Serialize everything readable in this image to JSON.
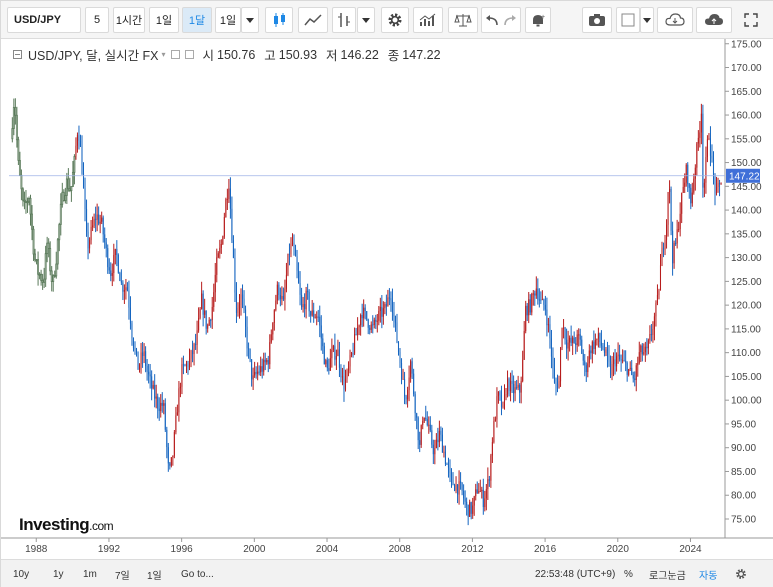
{
  "toolbar": {
    "symbol": "USD/JPY",
    "intervals": [
      "5",
      "1시간",
      "1일",
      "1달",
      "1일"
    ],
    "active_interval": "1달",
    "icons": [
      "chevron-down-icon",
      "candlestick-icon",
      "line-chart-icon",
      "indicator-icon",
      "chevron-down-icon",
      "gear-icon",
      "volume-icon",
      "scale-icon",
      "undo-icon",
      "redo-icon",
      "alert-bell-icon",
      "camera-icon",
      "color-square-icon",
      "chevron-down-icon",
      "cloud-load-icon",
      "cloud-save-icon",
      "fullscreen-icon"
    ]
  },
  "legend": {
    "name": "USD/JPY, 달, 실시간 FX",
    "open_label": "시",
    "open": "150.76",
    "high_label": "고",
    "high": "150.93",
    "low_label": "저",
    "low": "146.22",
    "close_label": "종",
    "close": "147.22"
  },
  "logo": {
    "brand": "Investing",
    "suffix": ".com"
  },
  "bottom": {
    "ranges": [
      "10y",
      "1y",
      "1m",
      "7일",
      "1일",
      "Go to..."
    ],
    "time": "22:53:48 (UTC+9)",
    "percent": "%",
    "log": "로그눈금",
    "auto": "자동",
    "settings_icon": "gear-icon"
  },
  "chart_data": {
    "type": "candlestick",
    "y_ticks": [
      75,
      80,
      85,
      90,
      95,
      100,
      105,
      110,
      115,
      120,
      125,
      130,
      135,
      140,
      145,
      150,
      155,
      160,
      165,
      170,
      175
    ],
    "x_ticks": [
      "1988",
      "1992",
      "1996",
      "2000",
      "2004",
      "2008",
      "2012",
      "2016",
      "2020",
      "2024"
    ],
    "ylim": [
      71,
      176
    ],
    "xlim": [
      1986.5,
      2025.9
    ],
    "last_price": 147.22,
    "last_price_label": "147.22",
    "colors": {
      "up": "#b71c1c",
      "down": "#1565c0",
      "hist": "#5a7a5a",
      "last": "#3f6fd8"
    },
    "series": {
      "name": "",
      "points": [
        [
          1986.6,
          155
        ],
        [
          1986.8,
          164
        ],
        [
          1987.0,
          150
        ],
        [
          1987.3,
          140
        ],
        [
          1987.6,
          143
        ],
        [
          1987.9,
          130
        ],
        [
          1988.1,
          127
        ],
        [
          1988.4,
          125
        ],
        [
          1988.6,
          133
        ],
        [
          1988.9,
          124
        ],
        [
          1989.1,
          130
        ],
        [
          1989.4,
          142
        ],
        [
          1989.7,
          146
        ],
        [
          1989.9,
          144
        ],
        [
          1990.1,
          150
        ],
        [
          1990.3,
          158
        ],
        [
          1990.5,
          150
        ],
        [
          1990.8,
          132
        ],
        [
          1991.0,
          135
        ],
        [
          1991.3,
          139
        ],
        [
          1991.6,
          137
        ],
        [
          1991.9,
          130
        ],
        [
          1992.1,
          127
        ],
        [
          1992.4,
          131
        ],
        [
          1992.7,
          124
        ],
        [
          1993.0,
          124
        ],
        [
          1993.3,
          113
        ],
        [
          1993.6,
          107
        ],
        [
          1993.9,
          110
        ],
        [
          1994.1,
          106
        ],
        [
          1994.4,
          102
        ],
        [
          1994.7,
          99
        ],
        [
          1995.0,
          99
        ],
        [
          1995.2,
          89
        ],
        [
          1995.3,
          84
        ],
        [
          1995.5,
          88
        ],
        [
          1995.8,
          100
        ],
        [
          1996.0,
          106
        ],
        [
          1996.4,
          108
        ],
        [
          1996.8,
          112
        ],
        [
          1997.1,
          121
        ],
        [
          1997.4,
          115
        ],
        [
          1997.7,
          120
        ],
        [
          1997.9,
          128
        ],
        [
          1998.2,
          133
        ],
        [
          1998.4,
          141
        ],
        [
          1998.6,
          146
        ],
        [
          1998.8,
          133
        ],
        [
          1999.0,
          119
        ],
        [
          1999.3,
          122
        ],
        [
          1999.6,
          112
        ],
        [
          1999.9,
          104
        ],
        [
          2000.2,
          106
        ],
        [
          2000.5,
          107
        ],
        [
          2000.8,
          109
        ],
        [
          2001.0,
          117
        ],
        [
          2001.3,
          124
        ],
        [
          2001.6,
          120
        ],
        [
          2001.9,
          131
        ],
        [
          2002.1,
          133
        ],
        [
          2002.3,
          128
        ],
        [
          2002.6,
          119
        ],
        [
          2002.9,
          122
        ],
        [
          2003.1,
          118
        ],
        [
          2003.5,
          118
        ],
        [
          2003.8,
          110
        ],
        [
          2004.0,
          106
        ],
        [
          2004.3,
          110
        ],
        [
          2004.6,
          110
        ],
        [
          2004.9,
          103
        ],
        [
          2005.1,
          105
        ],
        [
          2005.5,
          112
        ],
        [
          2005.9,
          119
        ],
        [
          2006.2,
          117
        ],
        [
          2006.5,
          115
        ],
        [
          2006.9,
          118
        ],
        [
          2007.2,
          119
        ],
        [
          2007.5,
          123
        ],
        [
          2007.8,
          114
        ],
        [
          2008.1,
          106
        ],
        [
          2008.3,
          100
        ],
        [
          2008.6,
          108
        ],
        [
          2008.9,
          97
        ],
        [
          2009.1,
          90
        ],
        [
          2009.3,
          98
        ],
        [
          2009.7,
          92
        ],
        [
          2009.9,
          89
        ],
        [
          2010.2,
          93
        ],
        [
          2010.5,
          88
        ],
        [
          2010.8,
          83
        ],
        [
          2011.1,
          82
        ],
        [
          2011.4,
          81
        ],
        [
          2011.7,
          77
        ],
        [
          2012.0,
          77
        ],
        [
          2012.3,
          82
        ],
        [
          2012.6,
          79
        ],
        [
          2012.9,
          83
        ],
        [
          2013.1,
          92
        ],
        [
          2013.4,
          101
        ],
        [
          2013.7,
          98
        ],
        [
          2013.9,
          104
        ],
        [
          2014.2,
          102
        ],
        [
          2014.6,
          102
        ],
        [
          2014.8,
          109
        ],
        [
          2014.9,
          119
        ],
        [
          2015.2,
          120
        ],
        [
          2015.5,
          124
        ],
        [
          2015.8,
          120
        ],
        [
          2016.0,
          120
        ],
        [
          2016.3,
          112
        ],
        [
          2016.5,
          103
        ],
        [
          2016.8,
          104
        ],
        [
          2016.9,
          117
        ],
        [
          2017.2,
          112
        ],
        [
          2017.5,
          112
        ],
        [
          2017.9,
          113
        ],
        [
          2018.2,
          106
        ],
        [
          2018.5,
          111
        ],
        [
          2018.9,
          113
        ],
        [
          2019.2,
          111
        ],
        [
          2019.6,
          106
        ],
        [
          2019.9,
          109
        ],
        [
          2020.2,
          108
        ],
        [
          2020.5,
          107
        ],
        [
          2020.9,
          104
        ],
        [
          2021.2,
          110
        ],
        [
          2021.6,
          110
        ],
        [
          2021.9,
          115
        ],
        [
          2022.2,
          121
        ],
        [
          2022.4,
          130
        ],
        [
          2022.7,
          138
        ],
        [
          2022.8,
          148
        ],
        [
          2023.0,
          130
        ],
        [
          2023.2,
          133
        ],
        [
          2023.5,
          142
        ],
        [
          2023.8,
          149
        ],
        [
          2024.0,
          141
        ],
        [
          2024.3,
          151
        ],
        [
          2024.5,
          157
        ],
        [
          2024.6,
          161
        ],
        [
          2024.7,
          143
        ],
        [
          2024.9,
          152
        ],
        [
          2025.0,
          157
        ],
        [
          2025.2,
          149
        ],
        [
          2025.4,
          143
        ],
        [
          2025.6,
          145
        ],
        [
          2025.7,
          147
        ]
      ]
    }
  }
}
